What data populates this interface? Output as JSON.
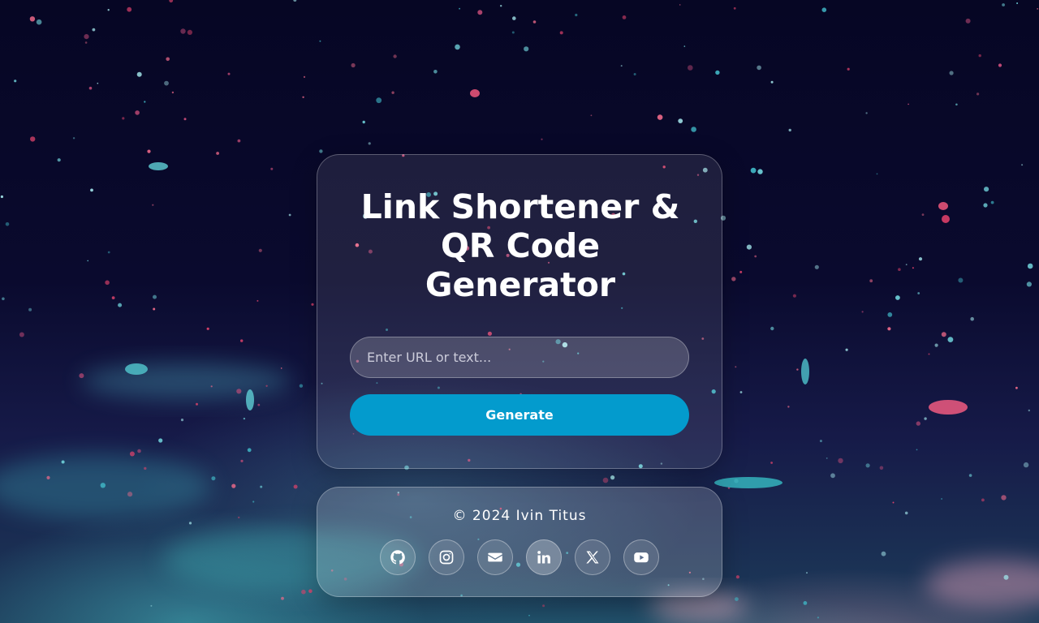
{
  "app": {
    "title": "Link Shortener & QR Code Generator"
  },
  "form": {
    "input_placeholder": "Enter URL or text...",
    "input_value": "",
    "generate_label": "Generate"
  },
  "footer": {
    "copyright": "© 2024 Ivin Titus",
    "social_links": [
      {
        "icon": "github-icon",
        "label": "GitHub"
      },
      {
        "icon": "instagram-icon",
        "label": "Instagram"
      },
      {
        "icon": "envelope-icon",
        "label": "Email"
      },
      {
        "icon": "linkedin-icon",
        "label": "LinkedIn"
      },
      {
        "icon": "x-twitter-icon",
        "label": "X"
      },
      {
        "icon": "youtube-icon",
        "label": "YouTube"
      }
    ]
  },
  "colors": {
    "background": "#060624",
    "accent": "#039bcd",
    "text": "#ffffff"
  }
}
